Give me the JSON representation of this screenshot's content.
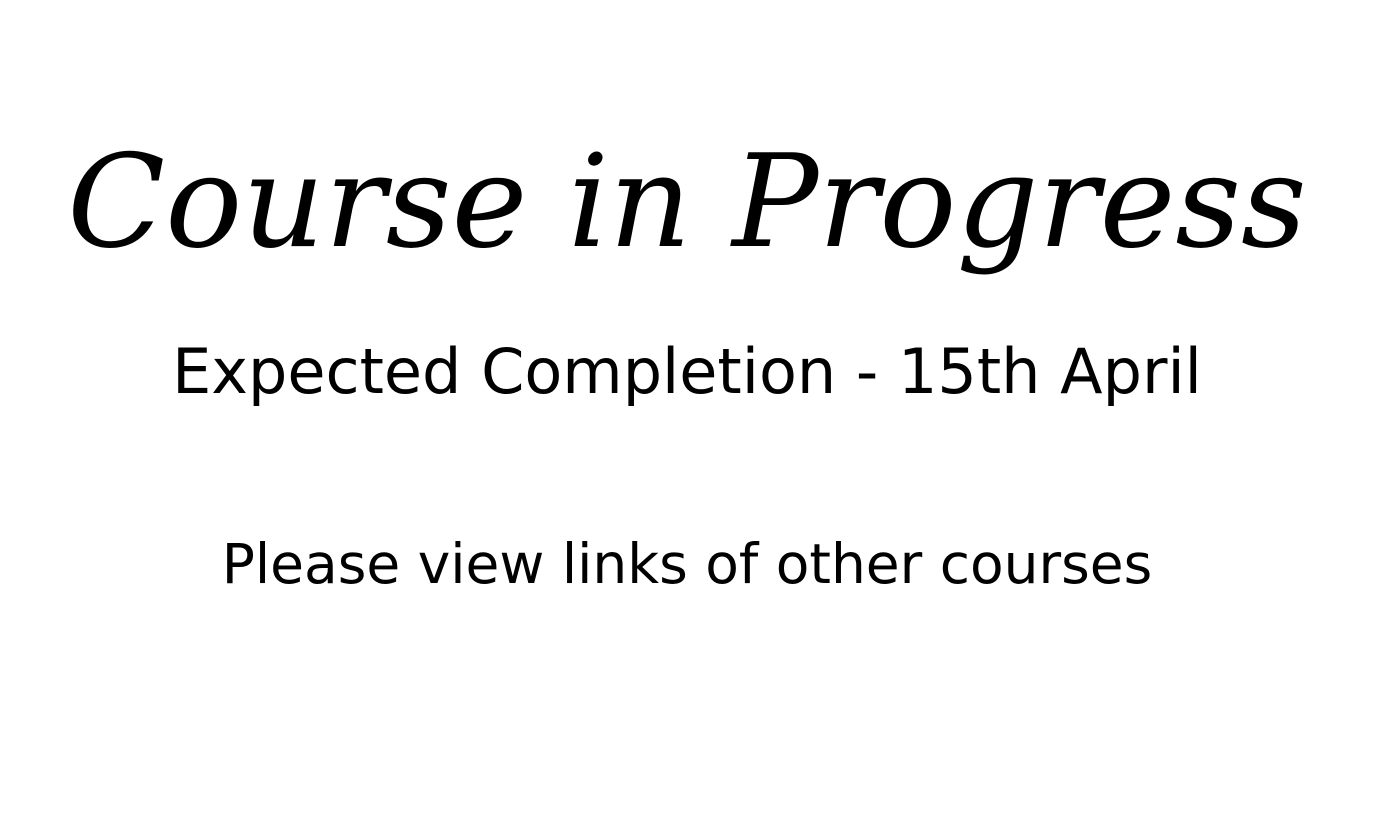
{
  "banner": {
    "title": "Course in Progress",
    "subtitle": "Expected Completion - 15th April",
    "note": "Please view links of other courses"
  },
  "colors": {
    "background": "#ffffff",
    "text": "#000000"
  }
}
